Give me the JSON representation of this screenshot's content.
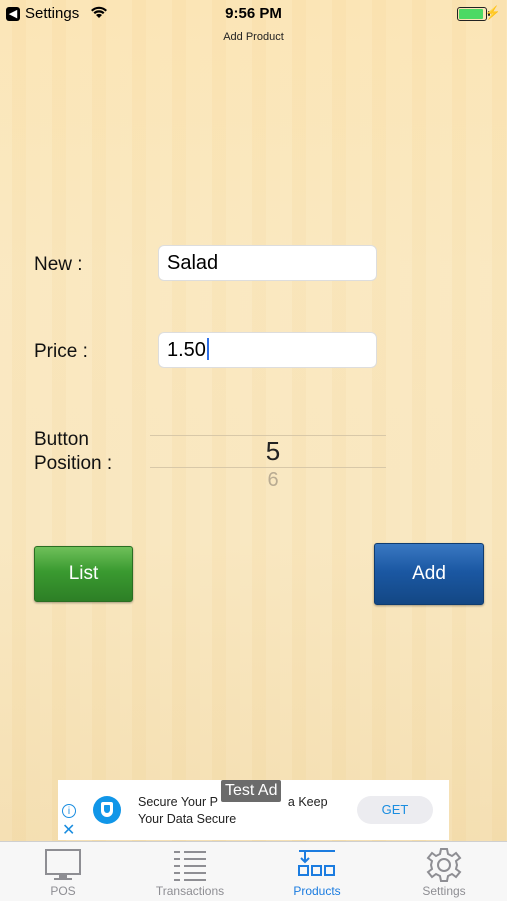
{
  "status": {
    "back_app": "Settings",
    "time": "9:56 PM",
    "battery_level": 1.0
  },
  "nav": {
    "title": "Add Product"
  },
  "form": {
    "name_label": "New :",
    "name_value": "Salad",
    "price_label": "Price :",
    "price_value": "1.50",
    "position_label_line1": "Button",
    "position_label_line2": "Position :",
    "position_selected": "5",
    "position_next": "6"
  },
  "buttons": {
    "list": "List",
    "add": "Add"
  },
  "ad": {
    "badge": "Test Ad",
    "line1": "Secure Your P",
    "line1b": "a Keep",
    "line2": "Your Data Secure",
    "get": "GET"
  },
  "tabs": [
    {
      "label": "POS",
      "icon": "monitor-icon"
    },
    {
      "label": "Transactions",
      "icon": "list-icon"
    },
    {
      "label": "Products",
      "icon": "products-icon",
      "active": true
    },
    {
      "label": "Settings",
      "icon": "gear-icon"
    }
  ],
  "colors": {
    "accent": "#1b7ce0",
    "list_button": "#3a9a30",
    "add_button": "#1b58a3"
  }
}
